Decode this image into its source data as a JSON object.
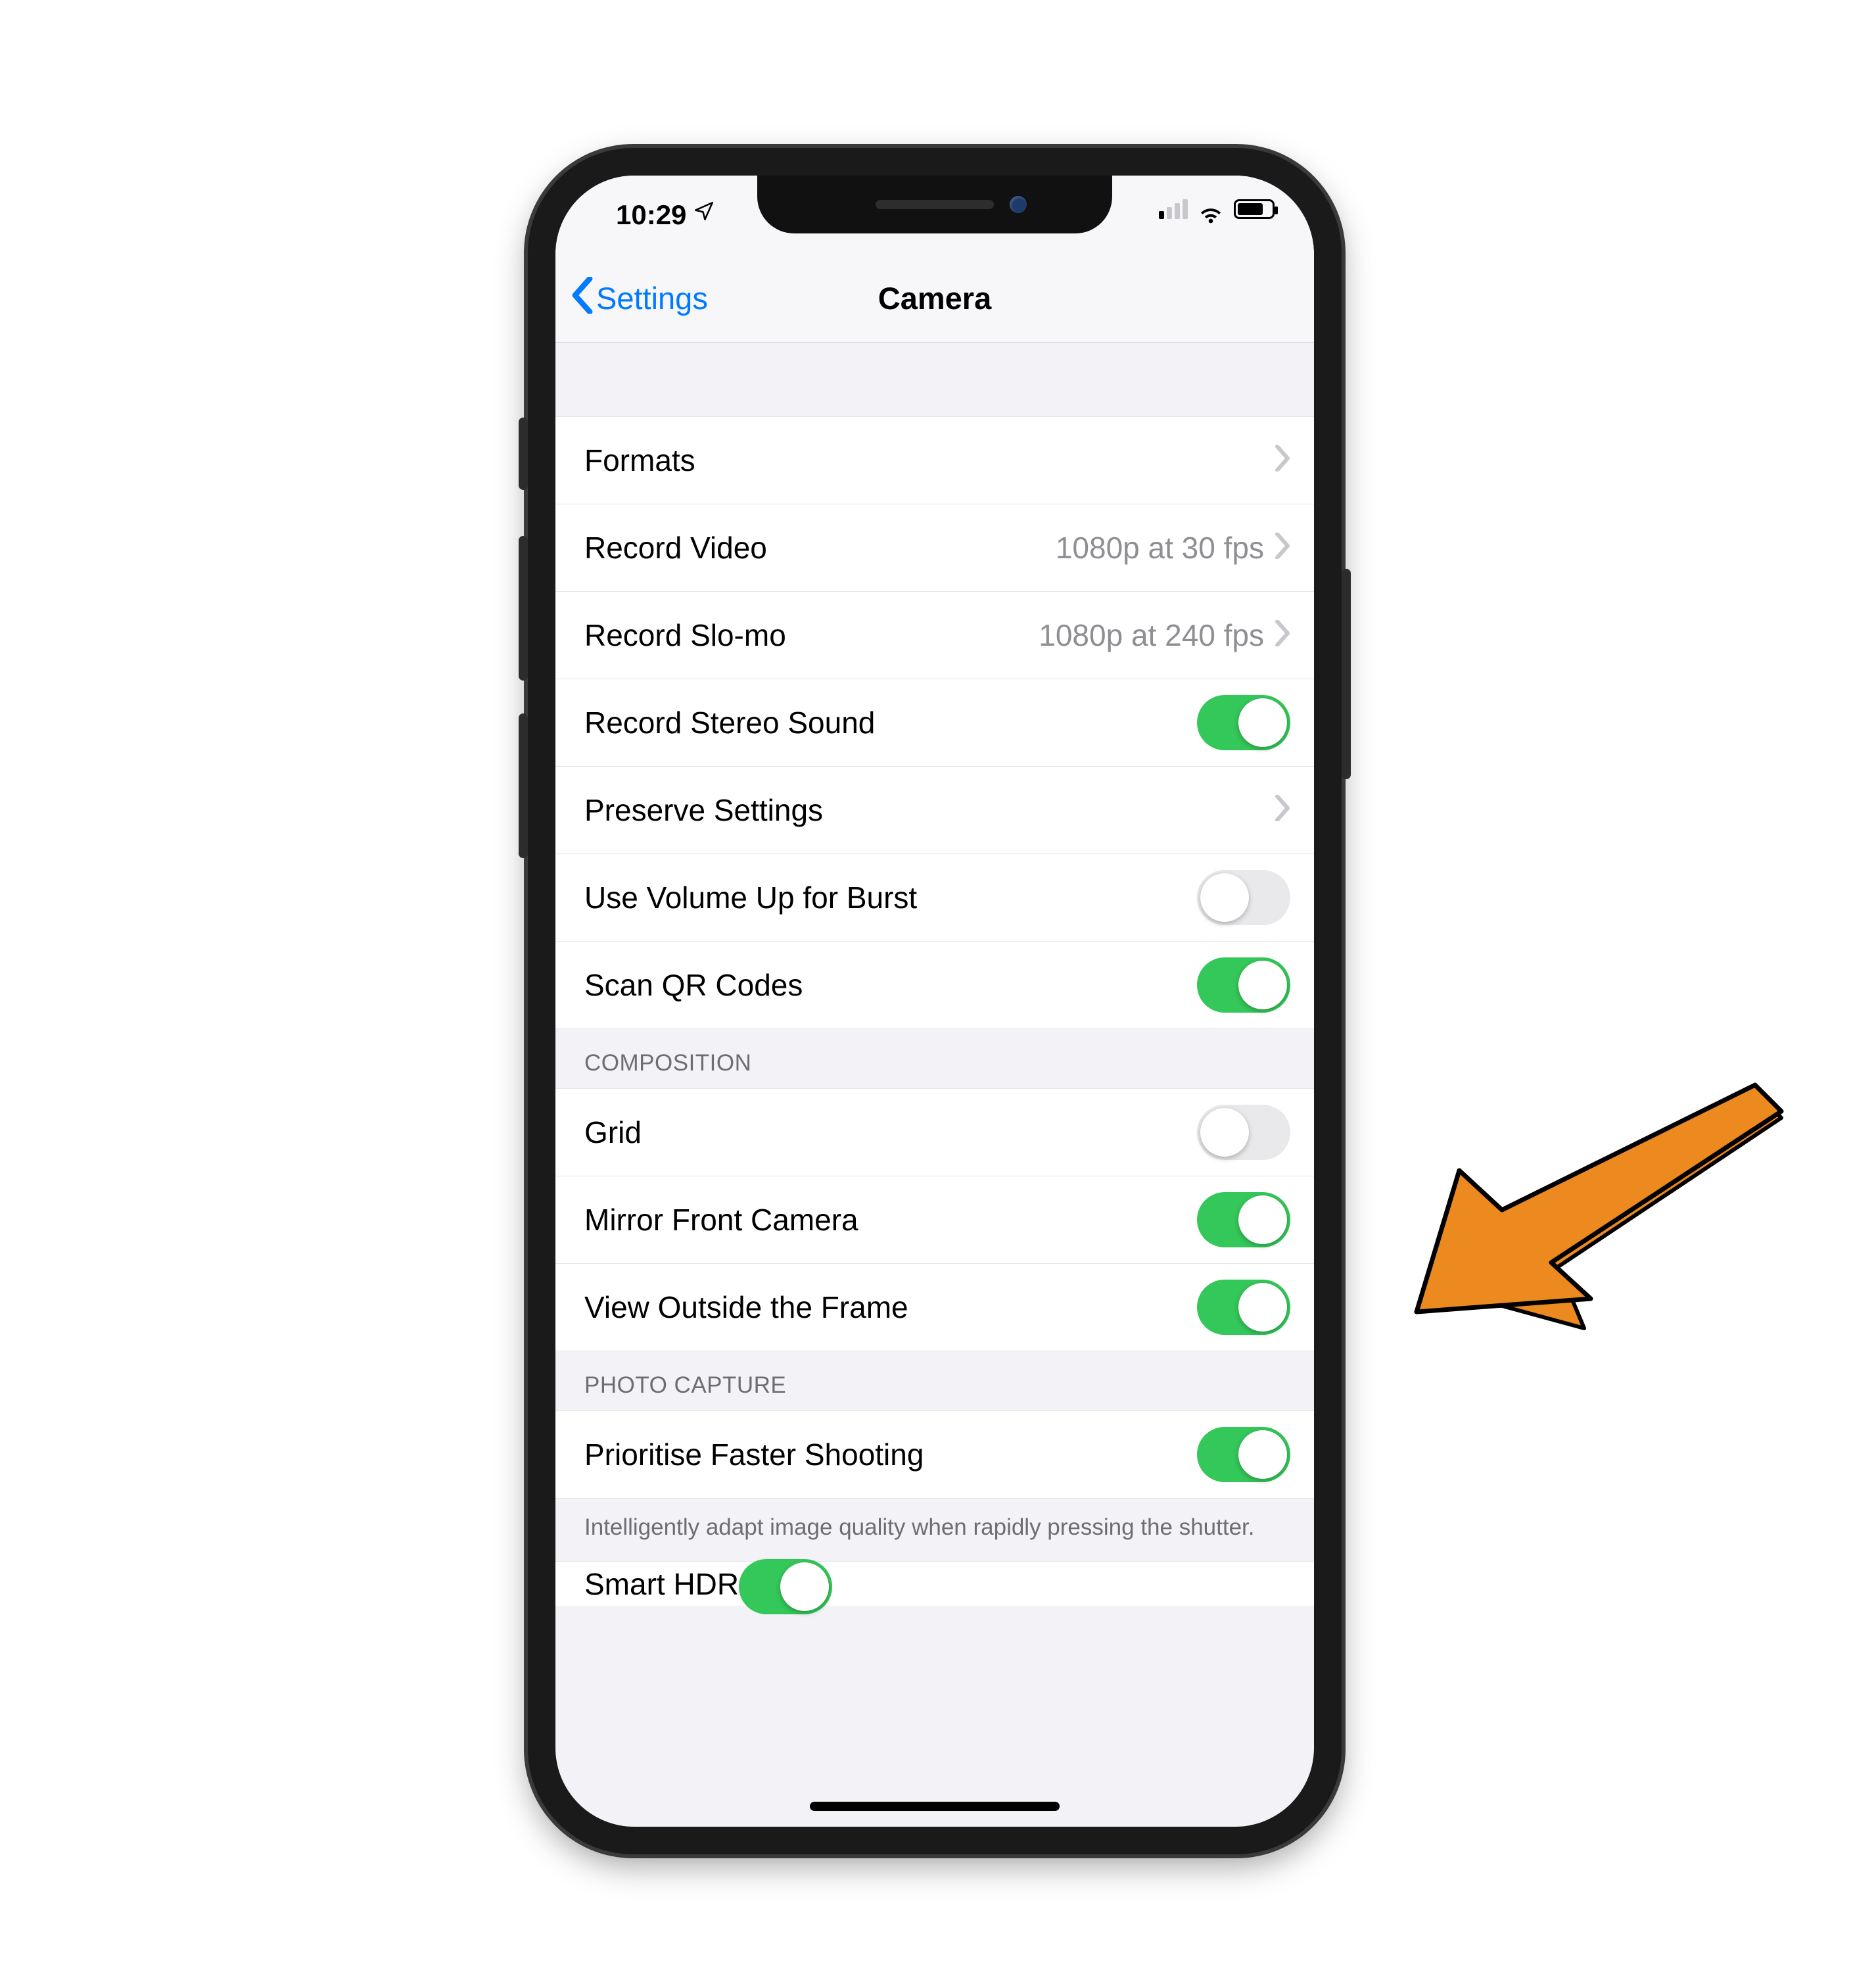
{
  "status": {
    "time": "10:29",
    "location_services": true,
    "signal_active_bars": 1,
    "wifi": true,
    "battery_pct": 70
  },
  "nav": {
    "back_label": "Settings",
    "title": "Camera"
  },
  "groups": [
    {
      "header": "",
      "footer": "",
      "rows": [
        {
          "key": "formats",
          "label": "Formats",
          "type": "link",
          "detail": ""
        },
        {
          "key": "recvideo",
          "label": "Record Video",
          "type": "link",
          "detail": "1080p at 30 fps"
        },
        {
          "key": "recslomo",
          "label": "Record Slo-mo",
          "type": "link",
          "detail": "1080p at 240 fps"
        },
        {
          "key": "stereo",
          "label": "Record Stereo Sound",
          "type": "toggle",
          "value": true
        },
        {
          "key": "preserve",
          "label": "Preserve Settings",
          "type": "link",
          "detail": ""
        },
        {
          "key": "volburst",
          "label": "Use Volume Up for Burst",
          "type": "toggle",
          "value": false
        },
        {
          "key": "qr",
          "label": "Scan QR Codes",
          "type": "toggle",
          "value": true
        }
      ]
    },
    {
      "header": "COMPOSITION",
      "footer": "",
      "rows": [
        {
          "key": "grid",
          "label": "Grid",
          "type": "toggle",
          "value": false
        },
        {
          "key": "mirror",
          "label": "Mirror Front Camera",
          "type": "toggle",
          "value": true
        },
        {
          "key": "outside",
          "label": "View Outside the Frame",
          "type": "toggle",
          "value": true
        }
      ]
    },
    {
      "header": "PHOTO CAPTURE",
      "footer": "Intelligently adapt image quality when rapidly pressing the shutter.",
      "rows": [
        {
          "key": "faster",
          "label": "Prioritise Faster Shooting",
          "type": "toggle",
          "value": true
        }
      ]
    }
  ],
  "partial_row": {
    "label": "Smart HDR",
    "type": "toggle",
    "value": true
  },
  "annotation": {
    "type": "arrow",
    "target_key": "mirror",
    "color": "#ec8a1f",
    "stroke": "#000000"
  }
}
